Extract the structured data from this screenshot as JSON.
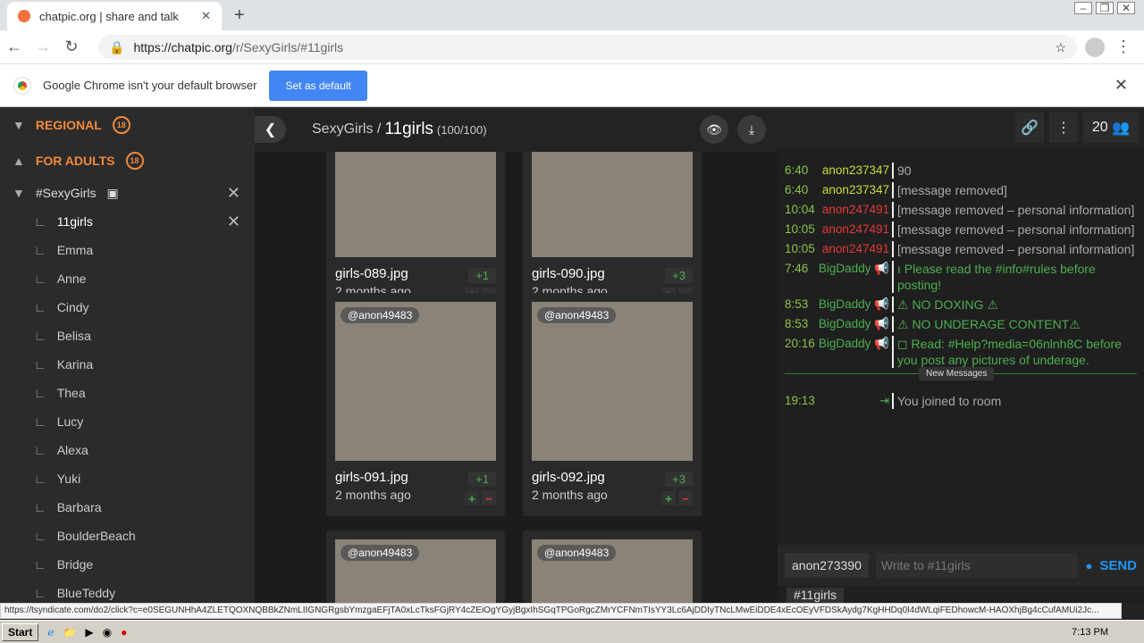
{
  "browser": {
    "tab_title": "chatpic.org | share and talk",
    "url_host": "https://chatpic.org",
    "url_path": "/r/SexyGirls/#11girls",
    "info_text": "Google Chrome isn't your default browser",
    "set_default": "Set as default"
  },
  "sidebar": {
    "sections": [
      {
        "label": "REGIONAL",
        "badge": "18"
      },
      {
        "label": "FOR ADULTS",
        "badge": "18"
      }
    ],
    "room": "#SexyGirls",
    "subrooms": [
      "11girls",
      "Emma",
      "Anne",
      "Cindy",
      "Belisa",
      "Karina",
      "Thea",
      "Lucy",
      "Alexa",
      "Yuki",
      "Barbara",
      "BoulderBeach",
      "Bridge",
      "BlueTeddy"
    ]
  },
  "gallery": {
    "room": "SexyGirls",
    "separator": "/",
    "album": "11girls",
    "count": "(100/100)",
    "cards": [
      {
        "file": "girls-089.jpg",
        "ago": "2 months ago",
        "votes": "+1",
        "uploader": ""
      },
      {
        "file": "girls-090.jpg",
        "ago": "2 months ago",
        "votes": "+3",
        "uploader": ""
      },
      {
        "file": "girls-091.jpg",
        "ago": "2 months ago",
        "votes": "+1",
        "uploader": "@anon49483"
      },
      {
        "file": "girls-092.jpg",
        "ago": "2 months ago",
        "votes": "+3",
        "uploader": "@anon49483"
      },
      {
        "file": "",
        "ago": "",
        "votes": "",
        "uploader": "@anon49483"
      },
      {
        "file": "",
        "ago": "",
        "votes": "",
        "uploader": "@anon49483"
      }
    ]
  },
  "chat": {
    "user_count": "20",
    "messages": [
      {
        "time": "6:40",
        "user": "anon237347",
        "color": "#cddc39",
        "text": "90"
      },
      {
        "time": "6:40",
        "user": "anon237347",
        "color": "#cddc39",
        "text": "[message removed]"
      },
      {
        "time": "10:04",
        "user": "anon247491",
        "color": "#e53935",
        "text": "[message removed – personal information]"
      },
      {
        "time": "10:05",
        "user": "anon247491",
        "color": "#e53935",
        "text": "[message removed – personal information]"
      },
      {
        "time": "10:05",
        "user": "anon247491",
        "color": "#e53935",
        "text": "[message removed – personal information]"
      },
      {
        "time": "7:46",
        "user": "BigDaddy",
        "color": "#4caf50",
        "text": "ı Please read the #info#rules before posting!"
      },
      {
        "time": "8:53",
        "user": "BigDaddy",
        "color": "#4caf50",
        "text": "⚠ NO DOXING ⚠"
      },
      {
        "time": "8:53",
        "user": "BigDaddy",
        "color": "#4caf50",
        "text": "⚠ NO UNDERAGE CONTENT⚠"
      },
      {
        "time": "20:16",
        "user": "BigDaddy",
        "color": "#4caf50",
        "text": "◻ Read: #Help?media=06nlnh8C before you post any pictures of underage."
      }
    ],
    "new_messages": "New Messages",
    "join_time": "19:13",
    "join_text": "You joined to room",
    "nick": "anon273390",
    "placeholder": "Write to #11girls",
    "send": "SEND",
    "channel": "#11girls"
  },
  "status_url": "https://tsyndicate.com/do2/click?c=e0SEGUNHhA4ZLETQOXNQBBkZNmLIIGNGRgsbYmzgaEFjTA0xLcTksFGjRY4cZEiOgYGyjBgxIhSGqTPGoRgcZMrYCFNmTIsYY3Lc6AjDDIyTNcLMwEiDDE4xEcOEyVFDSkAydg7KgHHDq0I4dWLqiFEDhowcM-HAOXhjBg4cCufAMUi2Jc...",
  "taskbar": {
    "start": "Start",
    "time": "7:13 PM"
  }
}
